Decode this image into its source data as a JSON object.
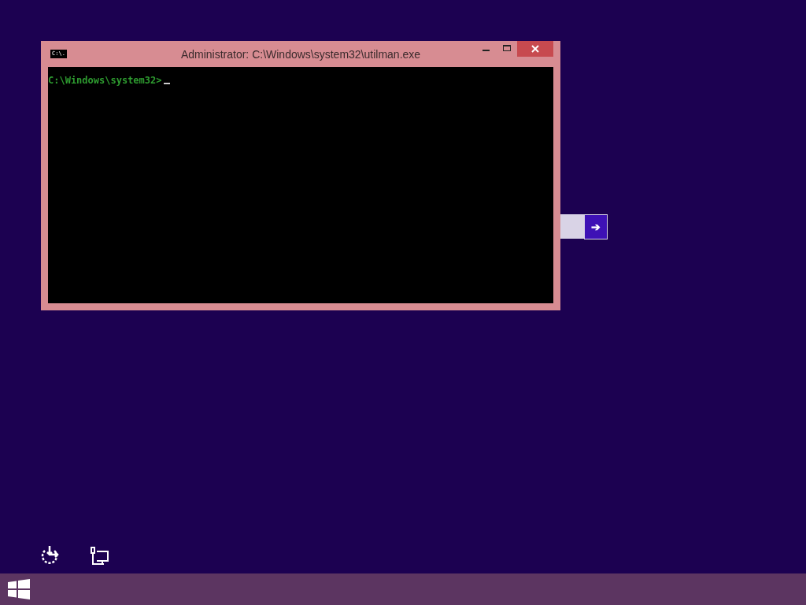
{
  "window": {
    "title": "Administrator: C:\\Windows\\system32\\utilman.exe",
    "icon_text": "C:\\.",
    "console": {
      "prompt": "C:\\Windows\\system32>",
      "cursor": true
    }
  },
  "password": {
    "submit": "➔"
  }
}
